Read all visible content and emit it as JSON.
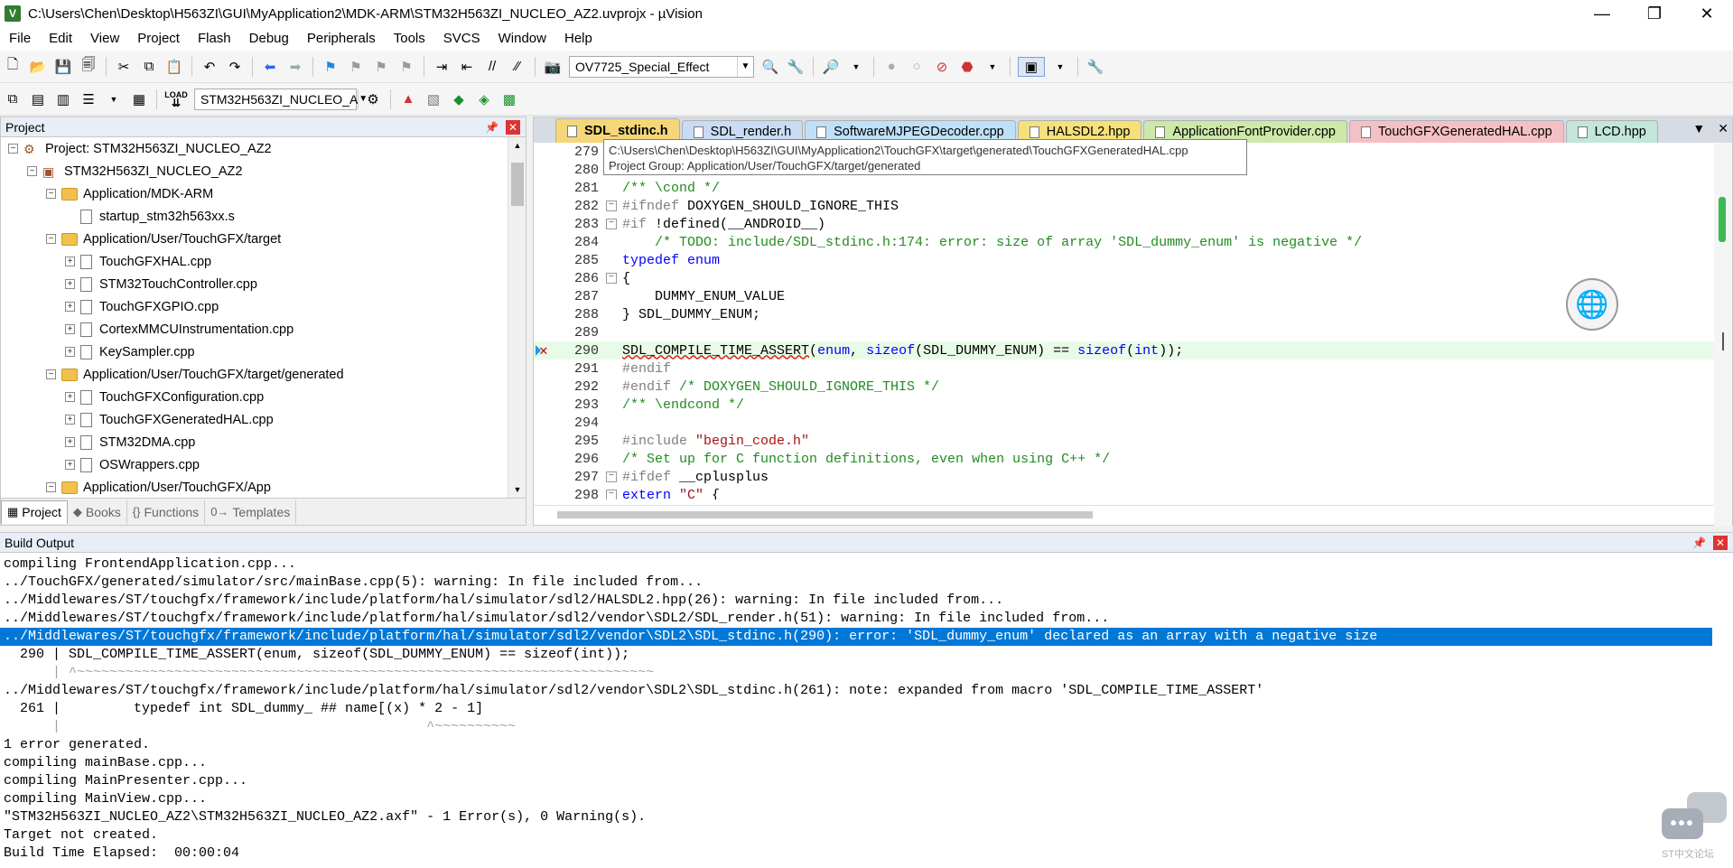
{
  "window": {
    "title": "C:\\Users\\Chen\\Desktop\\H563ZI\\GUI\\MyApplication2\\MDK-ARM\\STM32H563ZI_NUCLEO_AZ2.uvprojx - µVision",
    "app_icon_text": "V",
    "minimize": "—",
    "maximize": "❐",
    "close": "✕"
  },
  "menu": [
    "File",
    "Edit",
    "View",
    "Project",
    "Flash",
    "Debug",
    "Peripherals",
    "Tools",
    "SVCS",
    "Window",
    "Help"
  ],
  "toolbar1": {
    "effect_combo": "OV7725_Special_Effect"
  },
  "toolbar2": {
    "load_label": "LOAD",
    "target_combo": "STM32H563ZI_NUCLEO_A"
  },
  "project_panel": {
    "title": "Project",
    "pin": "📌",
    "close": "✕",
    "tree": [
      {
        "label": "Project: STM32H563ZI_NUCLEO_AZ2",
        "level": 0,
        "toggle": "−",
        "type": "project"
      },
      {
        "label": "STM32H563ZI_NUCLEO_AZ2",
        "level": 1,
        "toggle": "−",
        "type": "target"
      },
      {
        "label": "Application/MDK-ARM",
        "level": 2,
        "toggle": "−",
        "type": "folder"
      },
      {
        "label": "startup_stm32h563xx.s",
        "level": 3,
        "toggle": "",
        "type": "file"
      },
      {
        "label": "Application/User/TouchGFX/target",
        "level": 2,
        "toggle": "−",
        "type": "folder"
      },
      {
        "label": "TouchGFXHAL.cpp",
        "level": 3,
        "toggle": "+",
        "type": "file"
      },
      {
        "label": "STM32TouchController.cpp",
        "level": 3,
        "toggle": "+",
        "type": "file"
      },
      {
        "label": "TouchGFXGPIO.cpp",
        "level": 3,
        "toggle": "+",
        "type": "file"
      },
      {
        "label": "CortexMMCUInstrumentation.cpp",
        "level": 3,
        "toggle": "+",
        "type": "file"
      },
      {
        "label": "KeySampler.cpp",
        "level": 3,
        "toggle": "+",
        "type": "file"
      },
      {
        "label": "Application/User/TouchGFX/target/generated",
        "level": 2,
        "toggle": "−",
        "type": "folder"
      },
      {
        "label": "TouchGFXConfiguration.cpp",
        "level": 3,
        "toggle": "+",
        "type": "file"
      },
      {
        "label": "TouchGFXGeneratedHAL.cpp",
        "level": 3,
        "toggle": "+",
        "type": "file"
      },
      {
        "label": "STM32DMA.cpp",
        "level": 3,
        "toggle": "+",
        "type": "file"
      },
      {
        "label": "OSWrappers.cpp",
        "level": 3,
        "toggle": "+",
        "type": "file"
      },
      {
        "label": "Application/User/TouchGFX/App",
        "level": 2,
        "toggle": "−",
        "type": "folder"
      }
    ],
    "tabs": [
      {
        "label": "Project",
        "icon": "▦",
        "active": true
      },
      {
        "label": "Books",
        "icon": "◆",
        "active": false
      },
      {
        "label": "Functions",
        "icon": "{}",
        "active": false
      },
      {
        "label": "Templates",
        "icon": "0→",
        "active": false
      }
    ]
  },
  "editor": {
    "tabs": [
      {
        "label": "SDL_stdinc.h",
        "color": "#f5d77a",
        "active": true
      },
      {
        "label": "SDL_render.h",
        "color": "#c9dcf5",
        "active": false
      },
      {
        "label": "SoftwareMJPEGDecoder.cpp",
        "color": "#bfe0f7",
        "active": false
      },
      {
        "label": "HALSDL2.hpp",
        "color": "#f5e07a",
        "active": false
      },
      {
        "label": "ApplicationFontProvider.cpp",
        "color": "#cde8a8",
        "active": false
      },
      {
        "label": "TouchGFXGeneratedHAL.cpp",
        "color": "#f5c0c5",
        "active": false
      },
      {
        "label": "LCD.hpp",
        "color": "#c2e6d8",
        "active": false
      }
    ],
    "tab_menu": "▼",
    "tab_close": "✕",
    "tooltip_line1": "C:\\Users\\Chen\\Desktop\\H563ZI\\GUI\\MyApplication2\\TouchGFX\\target\\generated\\TouchGFXGeneratedHAL.cpp",
    "tooltip_line2": "Project Group: Application/User/TouchGFX/target/generated",
    "lines": [
      {
        "n": "279",
        "fold": "",
        "segs": [
          [
            "pl",
            ""
          ]
        ]
      },
      {
        "n": "280",
        "fold": "",
        "segs": [
          [
            "pl",
            ""
          ]
        ]
      },
      {
        "n": "281",
        "fold": "",
        "segs": [
          [
            "cm",
            "/** \\cond */"
          ]
        ]
      },
      {
        "n": "282",
        "fold": "−",
        "segs": [
          [
            "pp",
            "#ifndef "
          ],
          [
            "pl",
            "DOXYGEN_SHOULD_IGNORE_THIS"
          ]
        ]
      },
      {
        "n": "283",
        "fold": "−",
        "segs": [
          [
            "pp",
            "#if "
          ],
          [
            "pl",
            "!defined(__ANDROID__)"
          ]
        ]
      },
      {
        "n": "284",
        "fold": "",
        "segs": [
          [
            "cm",
            "    /* TODO: include/SDL_stdinc.h:174: error: size of array 'SDL_dummy_enum' is negative */"
          ]
        ]
      },
      {
        "n": "285",
        "fold": "",
        "segs": [
          [
            "kw",
            "typedef enum"
          ]
        ]
      },
      {
        "n": "286",
        "fold": "−",
        "segs": [
          [
            "pl",
            "{"
          ]
        ]
      },
      {
        "n": "287",
        "fold": "",
        "segs": [
          [
            "pl",
            "    DUMMY_ENUM_VALUE"
          ]
        ]
      },
      {
        "n": "288",
        "fold": "",
        "segs": [
          [
            "pl",
            "} SDL_DUMMY_ENUM;"
          ]
        ]
      },
      {
        "n": "289",
        "fold": "",
        "segs": [
          [
            "pl",
            ""
          ]
        ]
      },
      {
        "n": "290",
        "fold": "",
        "current": true,
        "marker": "✕",
        "segs": [
          [
            "err",
            "SDL_COMPILE_TIME_ASSERT"
          ],
          [
            "pl",
            "("
          ],
          [
            "kw",
            "enum"
          ],
          [
            "pl",
            ", "
          ],
          [
            "kw",
            "sizeof"
          ],
          [
            "pl",
            "(SDL_DUMMY_ENUM) == "
          ],
          [
            "kw",
            "sizeof"
          ],
          [
            "pl",
            "("
          ],
          [
            "kw",
            "int"
          ],
          [
            "pl",
            "));"
          ]
        ]
      },
      {
        "n": "291",
        "fold": "",
        "segs": [
          [
            "pp",
            "#endif"
          ]
        ]
      },
      {
        "n": "292",
        "fold": "",
        "segs": [
          [
            "pp",
            "#endif "
          ],
          [
            "cm",
            "/* DOXYGEN_SHOULD_IGNORE_THIS */"
          ]
        ]
      },
      {
        "n": "293",
        "fold": "",
        "segs": [
          [
            "cm",
            "/** \\endcond */"
          ]
        ]
      },
      {
        "n": "294",
        "fold": "",
        "segs": [
          [
            "pl",
            ""
          ]
        ]
      },
      {
        "n": "295",
        "fold": "",
        "segs": [
          [
            "pp",
            "#include "
          ],
          [
            "str",
            "\"begin_code.h\""
          ]
        ]
      },
      {
        "n": "296",
        "fold": "",
        "segs": [
          [
            "cm",
            "/* Set up for C function definitions, even when using C++ */"
          ]
        ]
      },
      {
        "n": "297",
        "fold": "−",
        "segs": [
          [
            "pp",
            "#ifdef "
          ],
          [
            "pl",
            "__cplusplus"
          ]
        ]
      },
      {
        "n": "298",
        "fold": "−",
        "segs": [
          [
            "kw",
            "extern "
          ],
          [
            "str",
            "\"C\""
          ],
          [
            "pl",
            " {"
          ]
        ]
      }
    ]
  },
  "build_output": {
    "title": "Build Output",
    "pin": "📌",
    "close": "✕",
    "lines": [
      {
        "text": "compiling FrontendApplication.cpp...",
        "style": ""
      },
      {
        "text": "../TouchGFX/generated/simulator/src/mainBase.cpp(5): warning: In file included from...",
        "style": ""
      },
      {
        "text": "../Middlewares/ST/touchgfx/framework/include/platform/hal/simulator/sdl2/HALSDL2.hpp(26): warning: In file included from...",
        "style": ""
      },
      {
        "text": "../Middlewares/ST/touchgfx/framework/include/platform/hal/simulator/sdl2/vendor\\SDL2/SDL_render.h(51): warning: In file included from...",
        "style": ""
      },
      {
        "text": "../Middlewares/ST/touchgfx/framework/include/platform/hal/simulator/sdl2/vendor\\SDL2\\SDL_stdinc.h(290): error: 'SDL_dummy_enum' declared as an array with a negative size",
        "style": "sel"
      },
      {
        "text": "  290 | SDL_COMPILE_TIME_ASSERT(enum, sizeof(SDL_DUMMY_ENUM) == sizeof(int));",
        "style": ""
      },
      {
        "text": "      | ^~~~~~~~~~~~~~~~~~~~~~~~~~~~~~~~~~~~~~~~~~~~~~~~~~~~~~~~~~~~~~~~~~~~~~~~",
        "style": "tilde"
      },
      {
        "text": "../Middlewares/ST/touchgfx/framework/include/platform/hal/simulator/sdl2/vendor\\SDL2\\SDL_stdinc.h(261): note: expanded from macro 'SDL_COMPILE_TIME_ASSERT'",
        "style": ""
      },
      {
        "text": "  261 |         typedef int SDL_dummy_ ## name[(x) * 2 - 1]",
        "style": ""
      },
      {
        "text": "      |                                             ^~~~~~~~~~~",
        "style": "tilde"
      },
      {
        "text": "1 error generated.",
        "style": ""
      },
      {
        "text": "compiling mainBase.cpp...",
        "style": ""
      },
      {
        "text": "compiling MainPresenter.cpp...",
        "style": ""
      },
      {
        "text": "compiling MainView.cpp...",
        "style": ""
      },
      {
        "text": "\"STM32H563ZI_NUCLEO_AZ2\\STM32H563ZI_NUCLEO_AZ2.axf\" - 1 Error(s), 0 Warning(s).",
        "style": ""
      },
      {
        "text": "Target not created.",
        "style": ""
      },
      {
        "text": "Build Time Elapsed:  00:00:04",
        "style": ""
      }
    ]
  },
  "watermark": {
    "glyph": "•••",
    "text": "ST中文论坛"
  }
}
